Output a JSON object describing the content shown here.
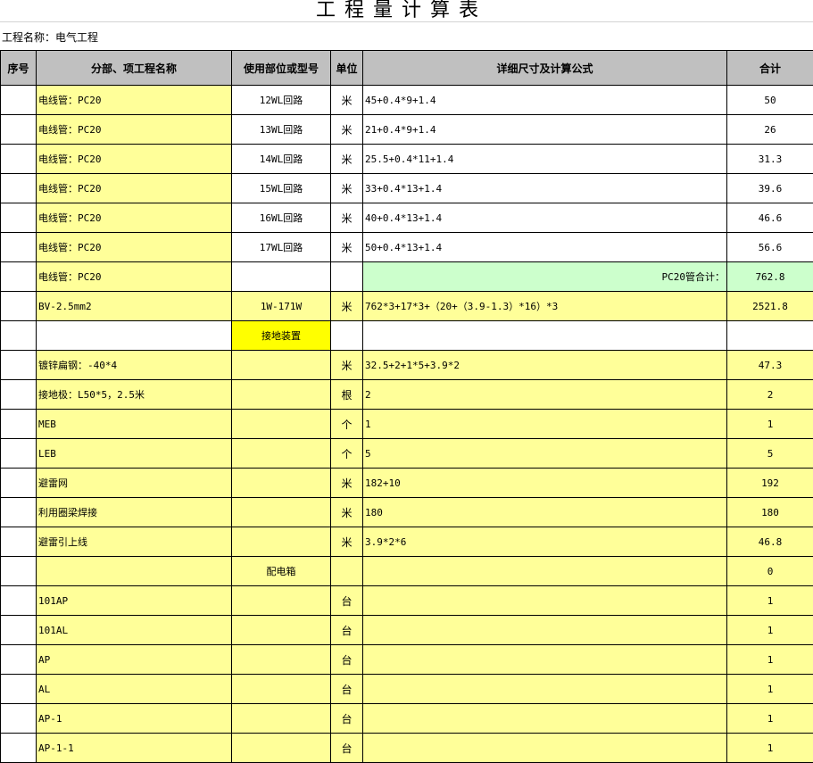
{
  "title": "工程量计算表",
  "project_label": "工程名称：电气工程",
  "headers": [
    "序号",
    "分部、项工程名称",
    "使用部位或型号",
    "单位",
    "详细尺寸及计算公式",
    "合计"
  ],
  "rows": [
    {
      "seq": "",
      "name": "电线管：PC20",
      "model": "12WL回路",
      "unit": "米",
      "formula": "45+0.4*9+1.4",
      "total": "50",
      "style": "w"
    },
    {
      "seq": "",
      "name": "电线管：PC20",
      "model": "13WL回路",
      "unit": "米",
      "formula": "21+0.4*9+1.4",
      "total": "26",
      "style": "w"
    },
    {
      "seq": "",
      "name": "电线管：PC20",
      "model": "14WL回路",
      "unit": "米",
      "formula": "25.5+0.4*11+1.4",
      "total": "31.3",
      "style": "w"
    },
    {
      "seq": "",
      "name": "电线管：PC20",
      "model": "15WL回路",
      "unit": "米",
      "formula": "33+0.4*13+1.4",
      "total": "39.6",
      "style": "w"
    },
    {
      "seq": "",
      "name": "电线管：PC20",
      "model": "16WL回路",
      "unit": "米",
      "formula": "40+0.4*13+1.4",
      "total": "46.6",
      "style": "w"
    },
    {
      "seq": "",
      "name": "电线管：PC20",
      "model": "17WL回路",
      "unit": "米",
      "formula": "50+0.4*13+1.4",
      "total": "56.6",
      "style": "w"
    },
    {
      "seq": "",
      "name": "电线管：PC20",
      "model": "",
      "unit": "",
      "formula": "PC20管合计：",
      "total": "762.8",
      "style": "sum"
    },
    {
      "seq": "",
      "name": "BV-2.5mm2",
      "model": "1W-171W",
      "unit": "米",
      "formula": "762*3+17*3+（20+（3.9-1.3）*16）*3",
      "total": "2521.8",
      "style": "y"
    },
    {
      "seq": "",
      "name": "",
      "model": "接地装置",
      "unit": "",
      "formula": "",
      "total": "",
      "style": "section"
    },
    {
      "seq": "",
      "name": "镀锌扁钢：-40*4",
      "model": "",
      "unit": "米",
      "formula": "32.5+2+1*5+3.9*2",
      "total": "47.3",
      "style": "y"
    },
    {
      "seq": "",
      "name": "接地极：L50*5，2.5米",
      "model": "",
      "unit": "根",
      "formula": "2",
      "total": "2",
      "style": "y"
    },
    {
      "seq": "",
      "name": "MEB",
      "model": "",
      "unit": "个",
      "formula": "1",
      "total": "1",
      "style": "y"
    },
    {
      "seq": "",
      "name": "LEB",
      "model": "",
      "unit": "个",
      "formula": "5",
      "total": "5",
      "style": "y"
    },
    {
      "seq": "",
      "name": "避雷网",
      "model": "",
      "unit": "米",
      "formula": "182+10",
      "total": "192",
      "style": "y"
    },
    {
      "seq": "",
      "name": "利用圈梁焊接",
      "model": "",
      "unit": "米",
      "formula": "180",
      "total": "180",
      "style": "y"
    },
    {
      "seq": "",
      "name": "避雷引上线",
      "model": "",
      "unit": "米",
      "formula": "3.9*2*6",
      "total": "46.8",
      "style": "y"
    },
    {
      "seq": "",
      "name": "",
      "model": "配电箱",
      "unit": "",
      "formula": "",
      "total": "0",
      "style": "y"
    },
    {
      "seq": "",
      "name": "101AP",
      "model": "",
      "unit": "台",
      "formula": "",
      "total": "1",
      "style": "y"
    },
    {
      "seq": "",
      "name": "101AL",
      "model": "",
      "unit": "台",
      "formula": "",
      "total": "1",
      "style": "y"
    },
    {
      "seq": "",
      "name": "AP",
      "model": "",
      "unit": "台",
      "formula": "",
      "total": "1",
      "style": "y"
    },
    {
      "seq": "",
      "name": "AL",
      "model": "",
      "unit": "台",
      "formula": "",
      "total": "1",
      "style": "y"
    },
    {
      "seq": "",
      "name": "AP-1",
      "model": "",
      "unit": "台",
      "formula": "",
      "total": "1",
      "style": "y"
    },
    {
      "seq": "",
      "name": "AP-1-1",
      "model": "",
      "unit": "台",
      "formula": "",
      "total": "1",
      "style": "y"
    }
  ],
  "colors": {
    "header_bg": "#c0c0c0",
    "row_yellow": "#ffff99",
    "sum_green": "#ccffcc",
    "section_yellow": "#ffff00"
  }
}
